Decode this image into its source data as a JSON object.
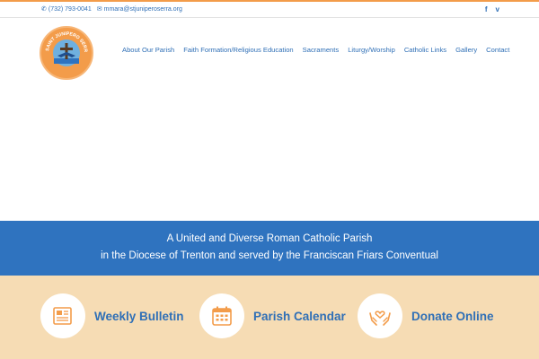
{
  "topbar": {
    "phone": "(732) 793-0041",
    "email": "mmara@stjuniperoserra.org",
    "phone_icon": "phone-icon",
    "email_icon": "envelope-icon",
    "social": [
      "f",
      "v"
    ]
  },
  "logo": {
    "text": "SAINT JUNIPERO SERRA PARISH",
    "colors": {
      "ring": "#f39c4a",
      "inner": "#6fb0df"
    }
  },
  "nav": {
    "items": [
      "About Our Parish",
      "Faith Formation/Religious Education",
      "Sacraments",
      "Liturgy/Worship",
      "Catholic Links",
      "Gallery",
      "Contact"
    ]
  },
  "banner": {
    "line1": "A United and Diverse Roman Catholic Parish",
    "line2": "in the Diocese of Trenton and served by the Franciscan Friars Conventual"
  },
  "cards": [
    {
      "label": "Weekly Bulletin",
      "icon": "newspaper-icon"
    },
    {
      "label": "Parish Calendar",
      "icon": "calendar-icon"
    },
    {
      "label": "Donate Online",
      "icon": "heart-hands-icon"
    }
  ],
  "colors": {
    "brand_blue": "#2f73bf",
    "accent_orange": "#f39c4a",
    "cards_background": "#f6dcb4"
  }
}
